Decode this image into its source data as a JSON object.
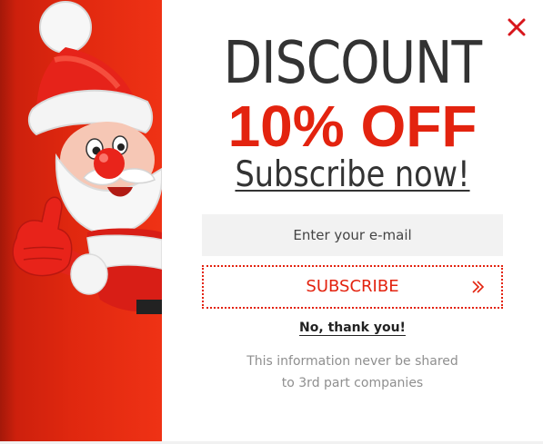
{
  "popup": {
    "headline": "DISCOUNT",
    "offer": "10% OFF",
    "cta_heading": "Subscribe now!",
    "email": {
      "value": "",
      "placeholder": "Enter your e-mail"
    },
    "subscribe_label": "SUBSCRIBE",
    "decline_label": "No, thank you!",
    "disclaimer_line1": "This information never be shared",
    "disclaimer_line2": "to 3rd part companies"
  },
  "icons": {
    "close": "close-icon",
    "arrow": "double-chevron-right-icon",
    "illustration": "santa-claus-thumbs-up-illustration"
  },
  "colors": {
    "accent": "#e3230f",
    "panel_red": "#e0280f",
    "heading_text": "#333333",
    "muted_text": "#8f8f8f",
    "input_bg": "#f2f2f2"
  }
}
